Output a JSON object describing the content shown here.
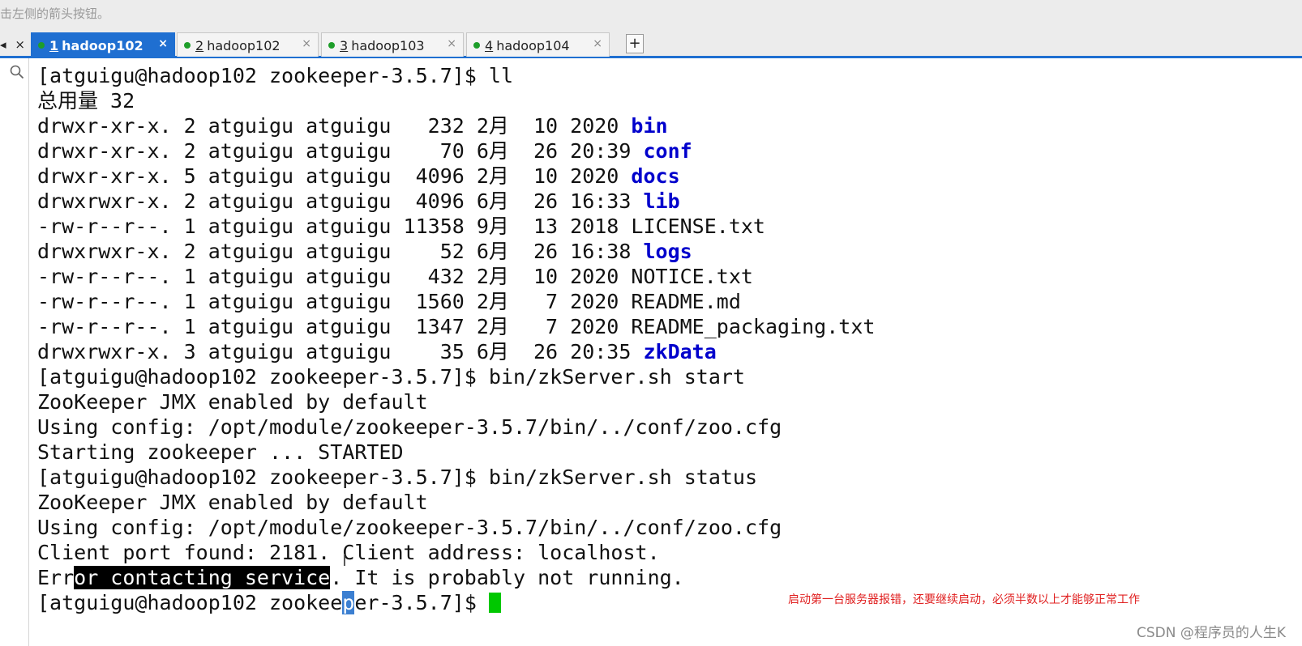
{
  "topbar": {
    "hint": "击左侧的箭头按钮。"
  },
  "left_controls": {
    "arrow": "◂",
    "close": "×"
  },
  "tabs": [
    {
      "num": "1",
      "label": "hadoop102",
      "active": true,
      "close": "×"
    },
    {
      "num": "2",
      "label": "hadoop102",
      "active": false,
      "close": "×"
    },
    {
      "num": "3",
      "label": "hadoop103",
      "active": false,
      "close": "×"
    },
    {
      "num": "4",
      "label": "hadoop104",
      "active": false,
      "close": "×"
    }
  ],
  "add_tab": "+",
  "terminal": {
    "lines": [
      {
        "a": "[atguigu@hadoop102 zookeeper-3.5.7]$ ll"
      },
      {
        "a": "总用量 32"
      },
      {
        "a": "drwxr-xr-x. 2 atguigu atguigu   232 2月  10 2020 ",
        "dir": "bin"
      },
      {
        "a": "drwxr-xr-x. 2 atguigu atguigu    70 6月  26 20:39 ",
        "dir": "conf"
      },
      {
        "a": "drwxr-xr-x. 5 atguigu atguigu  4096 2月  10 2020 ",
        "dir": "docs"
      },
      {
        "a": "drwxrwxr-x. 2 atguigu atguigu  4096 6月  26 16:33 ",
        "dir": "lib"
      },
      {
        "a": "-rw-r--r--. 1 atguigu atguigu 11358 9月  13 2018 LICENSE.txt"
      },
      {
        "a": "drwxrwxr-x. 2 atguigu atguigu    52 6月  26 16:38 ",
        "dir": "logs"
      },
      {
        "a": "-rw-r--r--. 1 atguigu atguigu   432 2月  10 2020 NOTICE.txt"
      },
      {
        "a": "-rw-r--r--. 1 atguigu atguigu  1560 2月   7 2020 README.md"
      },
      {
        "a": "-rw-r--r--. 1 atguigu atguigu  1347 2月   7 2020 README_packaging.txt"
      },
      {
        "a": "drwxrwxr-x. 3 atguigu atguigu    35 6月  26 20:35 ",
        "dir": "zkData"
      },
      {
        "a": "[atguigu@hadoop102 zookeeper-3.5.7]$ bin/zkServer.sh start"
      },
      {
        "a": "ZooKeeper JMX enabled by default"
      },
      {
        "a": "Using config: /opt/module/zookeeper-3.5.7/bin/../conf/zoo.cfg"
      },
      {
        "a": "Starting zookeeper ... STARTED"
      },
      {
        "a": "[atguigu@hadoop102 zookeeper-3.5.7]$ bin/zkServer.sh status"
      },
      {
        "a": "ZooKeeper JMX enabled by default"
      },
      {
        "a": "Using config: /opt/module/zookeeper-3.5.7/bin/../conf/zoo.cfg"
      },
      {
        "a": "Client port found: 2181. Client address: localhost."
      },
      {
        "a": "Err",
        "sel": "or contacting service",
        "b": ". It is probably not running."
      },
      {
        "a": "[atguigu@hadoop102 zookee",
        "selblue": "p",
        "b": "er-3.5.7]$ ",
        "cursor": true
      }
    ]
  },
  "annotation": "启动第一台服务器报错，还要继续启动，必须半数以上才能够正常工作",
  "watermark": "CSDN @程序员的人生K",
  "colors": {
    "accent": "#1f6fd1",
    "dir": "#0000cc",
    "cursor": "#00c800",
    "note": "#e02020",
    "status_dot": "#1e9e2a"
  }
}
